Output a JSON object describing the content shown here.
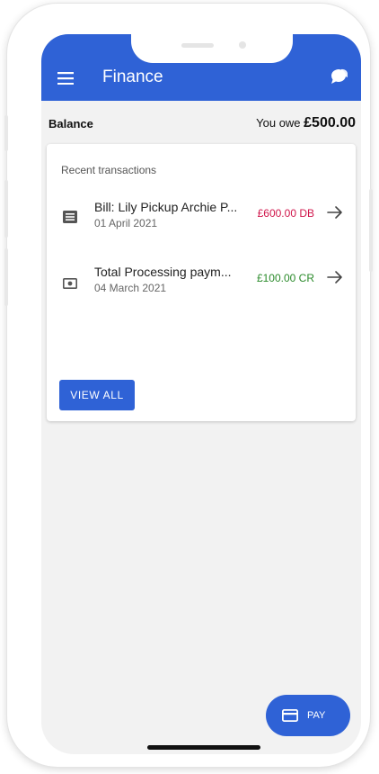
{
  "app": {
    "title": "Finance"
  },
  "icons": {
    "menu": "menu-icon",
    "chat": "chat-bubbles-icon",
    "bill": "receipt-icon",
    "payment": "banknote-icon",
    "arrow": "arrow-right-icon",
    "pay": "credit-card-icon"
  },
  "colors": {
    "primary": "#2f62d6",
    "debit": "#d0164b",
    "credit": "#2a8a2a",
    "background": "#f2f2f2"
  },
  "balance": {
    "label": "Balance",
    "prefix": "You owe ",
    "amount": "£500.00"
  },
  "recent": {
    "title": "Recent transactions",
    "items": [
      {
        "title": "Bill: Lily Pickup Archie P...",
        "date": "01 April 2021",
        "amount": "£600.00 DB",
        "kind": "debit"
      },
      {
        "title": "Total Processing paym...",
        "date": "04 March 2021",
        "amount": "£100.00 CR",
        "kind": "credit"
      }
    ],
    "view_all_label": "VIEW ALL"
  },
  "fab": {
    "label": "PAY"
  }
}
